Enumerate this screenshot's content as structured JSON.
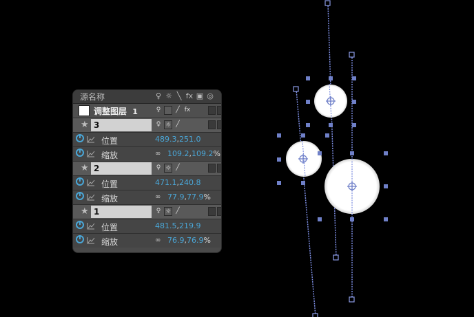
{
  "panel": {
    "header_label": "源名称",
    "header_switches": [
      "♀",
      "☼",
      "╲",
      "fx",
      "▣",
      "◎"
    ],
    "adjustment_layer": {
      "name": "调整图层",
      "index": "1"
    },
    "layers": [
      {
        "index": "3",
        "position": {
          "label": "位置",
          "x": "489.3",
          "y": "251.0"
        },
        "scale": {
          "label": "缩放",
          "x": "109.2",
          "y": "109.2",
          "unit": "%"
        }
      },
      {
        "index": "2",
        "position": {
          "label": "位置",
          "x": "471.1",
          "y": "240.8"
        },
        "scale": {
          "label": "缩放",
          "x": "77.9",
          "y": "77.9",
          "unit": "%"
        }
      },
      {
        "index": "1",
        "position": {
          "label": "位置",
          "x": "481.5",
          "y": "219.9"
        },
        "scale": {
          "label": "缩放",
          "x": "76.9",
          "y": "76.9",
          "unit": "%"
        }
      }
    ],
    "separator": ","
  },
  "colors": {
    "value_blue": "#4aa7d8",
    "handle_blue": "#6f80c8",
    "background": "#000000"
  }
}
